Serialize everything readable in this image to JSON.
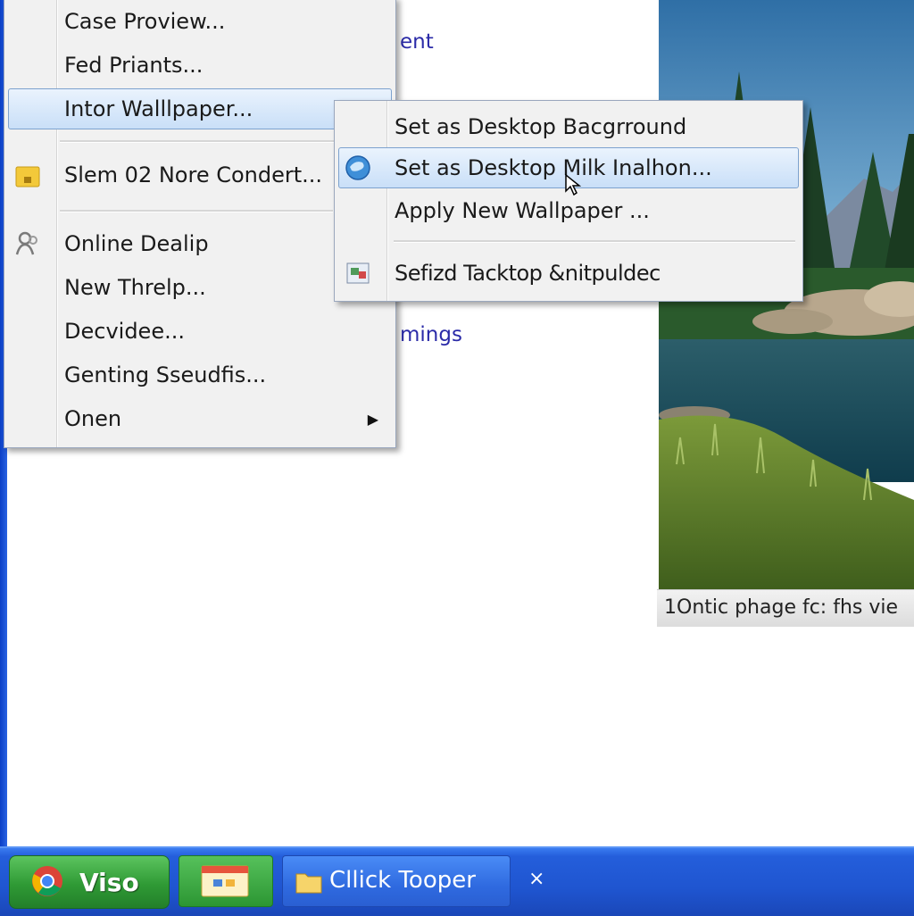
{
  "page": {
    "link_top": "ent",
    "link_mid": "mings"
  },
  "photo": {
    "caption": "1Ontic phage  fc: fhs vie"
  },
  "main_menu": {
    "items": [
      {
        "label": "Case Proview...",
        "icon": ""
      },
      {
        "label": "Fed Priants...",
        "icon": ""
      },
      {
        "label": "Intor Walllpaper...",
        "icon": "",
        "submenu": true,
        "highlighted": true
      },
      {
        "label": "Slem 02 Nore Condert...",
        "icon": "folder-lock-icon"
      },
      {
        "label": "Online Dealip",
        "icon": "people-icon"
      },
      {
        "label": "New Threlp...",
        "icon": ""
      },
      {
        "label": "Decvidee...",
        "icon": ""
      },
      {
        "label": "Genting Sseudfis...",
        "icon": ""
      },
      {
        "label": "Onen",
        "icon": "",
        "submenu": true
      }
    ]
  },
  "sub_menu": {
    "items": [
      {
        "label": "Set as Desktop Bacgrround",
        "icon": ""
      },
      {
        "label": "Set as Desktop Milk Inalhon...",
        "icon": "globe-icon",
        "highlighted": true
      },
      {
        "label": "Apply New Wallpaper ...",
        "icon": ""
      },
      {
        "label": "Sefizd Tacktop &nitpuldec",
        "icon": "desktop-settings-icon"
      }
    ]
  },
  "taskbar": {
    "start_label": "Viso",
    "start_icon": "chrome-icon",
    "folder_icon": "folder-window-icon",
    "task_label": "Cllick Tooper",
    "task_icon": "folder-icon",
    "close_label": "×"
  },
  "colors": {
    "taskbar_blue": "#245edb",
    "start_green": "#2f9a35",
    "menu_highlight": "#c9dff8",
    "link_color": "#2b2ba8"
  }
}
